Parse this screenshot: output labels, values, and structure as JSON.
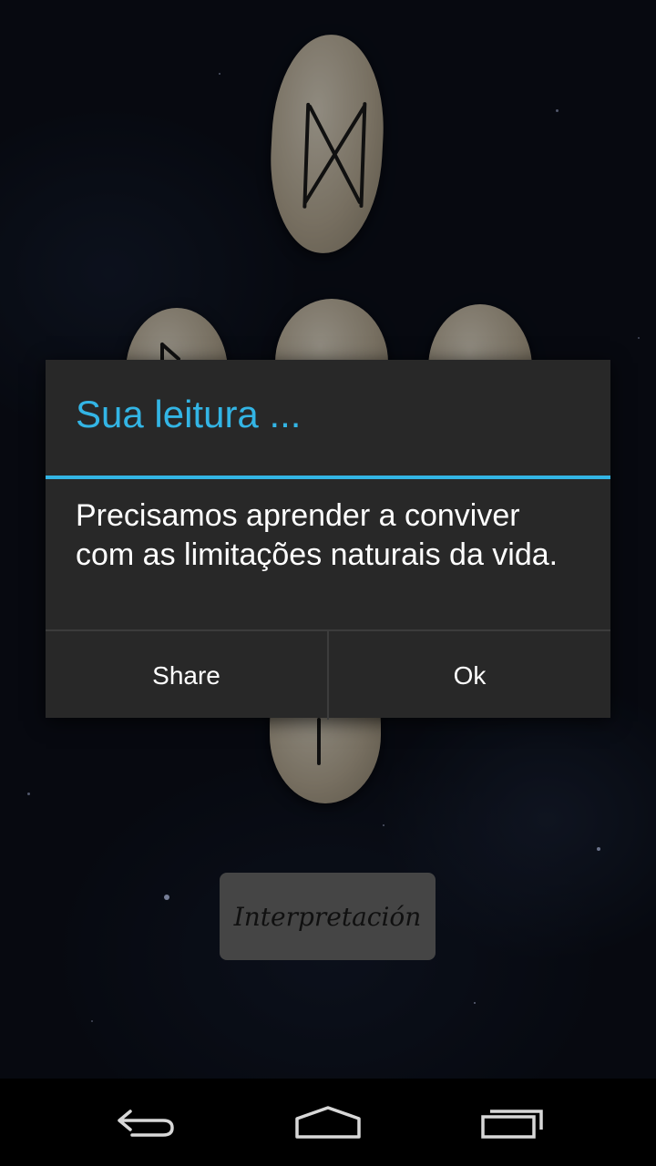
{
  "dialog": {
    "title": "Sua leitura ...",
    "message": "Precisamos aprender a conviver com as limitações naturais da vida.",
    "share_label": "Share",
    "ok_label": "Ok"
  },
  "main": {
    "interpretation_label": "Interpretación"
  },
  "navbar": {
    "back_icon": "back-icon",
    "home_icon": "home-icon",
    "recents_icon": "recent-apps-icon"
  },
  "colors": {
    "accent": "#33b5e5",
    "dialog_bg": "#282828",
    "button_bg": "#6a6a6a"
  }
}
